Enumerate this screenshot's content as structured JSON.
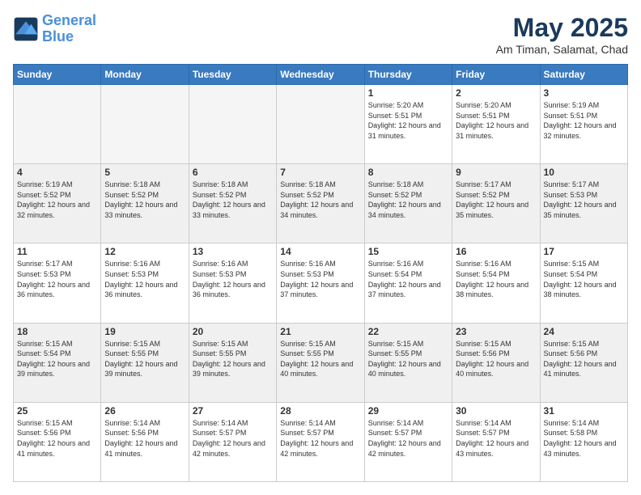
{
  "header": {
    "logo_line1": "General",
    "logo_line2": "Blue",
    "month_title": "May 2025",
    "location": "Am Timan, Salamat, Chad"
  },
  "days_of_week": [
    "Sunday",
    "Monday",
    "Tuesday",
    "Wednesday",
    "Thursday",
    "Friday",
    "Saturday"
  ],
  "weeks": [
    [
      {
        "day": "",
        "empty": true
      },
      {
        "day": "",
        "empty": true
      },
      {
        "day": "",
        "empty": true
      },
      {
        "day": "",
        "empty": true
      },
      {
        "day": "1",
        "sunrise": "5:20 AM",
        "sunset": "5:51 PM",
        "daylight": "12 hours and 31 minutes."
      },
      {
        "day": "2",
        "sunrise": "5:20 AM",
        "sunset": "5:51 PM",
        "daylight": "12 hours and 31 minutes."
      },
      {
        "day": "3",
        "sunrise": "5:19 AM",
        "sunset": "5:51 PM",
        "daylight": "12 hours and 32 minutes."
      }
    ],
    [
      {
        "day": "4",
        "sunrise": "5:19 AM",
        "sunset": "5:52 PM",
        "daylight": "12 hours and 32 minutes."
      },
      {
        "day": "5",
        "sunrise": "5:18 AM",
        "sunset": "5:52 PM",
        "daylight": "12 hours and 33 minutes."
      },
      {
        "day": "6",
        "sunrise": "5:18 AM",
        "sunset": "5:52 PM",
        "daylight": "12 hours and 33 minutes."
      },
      {
        "day": "7",
        "sunrise": "5:18 AM",
        "sunset": "5:52 PM",
        "daylight": "12 hours and 34 minutes."
      },
      {
        "day": "8",
        "sunrise": "5:18 AM",
        "sunset": "5:52 PM",
        "daylight": "12 hours and 34 minutes."
      },
      {
        "day": "9",
        "sunrise": "5:17 AM",
        "sunset": "5:52 PM",
        "daylight": "12 hours and 35 minutes."
      },
      {
        "day": "10",
        "sunrise": "5:17 AM",
        "sunset": "5:53 PM",
        "daylight": "12 hours and 35 minutes."
      }
    ],
    [
      {
        "day": "11",
        "sunrise": "5:17 AM",
        "sunset": "5:53 PM",
        "daylight": "12 hours and 36 minutes."
      },
      {
        "day": "12",
        "sunrise": "5:16 AM",
        "sunset": "5:53 PM",
        "daylight": "12 hours and 36 minutes."
      },
      {
        "day": "13",
        "sunrise": "5:16 AM",
        "sunset": "5:53 PM",
        "daylight": "12 hours and 36 minutes."
      },
      {
        "day": "14",
        "sunrise": "5:16 AM",
        "sunset": "5:53 PM",
        "daylight": "12 hours and 37 minutes."
      },
      {
        "day": "15",
        "sunrise": "5:16 AM",
        "sunset": "5:54 PM",
        "daylight": "12 hours and 37 minutes."
      },
      {
        "day": "16",
        "sunrise": "5:16 AM",
        "sunset": "5:54 PM",
        "daylight": "12 hours and 38 minutes."
      },
      {
        "day": "17",
        "sunrise": "5:15 AM",
        "sunset": "5:54 PM",
        "daylight": "12 hours and 38 minutes."
      }
    ],
    [
      {
        "day": "18",
        "sunrise": "5:15 AM",
        "sunset": "5:54 PM",
        "daylight": "12 hours and 39 minutes."
      },
      {
        "day": "19",
        "sunrise": "5:15 AM",
        "sunset": "5:55 PM",
        "daylight": "12 hours and 39 minutes."
      },
      {
        "day": "20",
        "sunrise": "5:15 AM",
        "sunset": "5:55 PM",
        "daylight": "12 hours and 39 minutes."
      },
      {
        "day": "21",
        "sunrise": "5:15 AM",
        "sunset": "5:55 PM",
        "daylight": "12 hours and 40 minutes."
      },
      {
        "day": "22",
        "sunrise": "5:15 AM",
        "sunset": "5:55 PM",
        "daylight": "12 hours and 40 minutes."
      },
      {
        "day": "23",
        "sunrise": "5:15 AM",
        "sunset": "5:56 PM",
        "daylight": "12 hours and 40 minutes."
      },
      {
        "day": "24",
        "sunrise": "5:15 AM",
        "sunset": "5:56 PM",
        "daylight": "12 hours and 41 minutes."
      }
    ],
    [
      {
        "day": "25",
        "sunrise": "5:15 AM",
        "sunset": "5:56 PM",
        "daylight": "12 hours and 41 minutes."
      },
      {
        "day": "26",
        "sunrise": "5:14 AM",
        "sunset": "5:56 PM",
        "daylight": "12 hours and 41 minutes."
      },
      {
        "day": "27",
        "sunrise": "5:14 AM",
        "sunset": "5:57 PM",
        "daylight": "12 hours and 42 minutes."
      },
      {
        "day": "28",
        "sunrise": "5:14 AM",
        "sunset": "5:57 PM",
        "daylight": "12 hours and 42 minutes."
      },
      {
        "day": "29",
        "sunrise": "5:14 AM",
        "sunset": "5:57 PM",
        "daylight": "12 hours and 42 minutes."
      },
      {
        "day": "30",
        "sunrise": "5:14 AM",
        "sunset": "5:57 PM",
        "daylight": "12 hours and 43 minutes."
      },
      {
        "day": "31",
        "sunrise": "5:14 AM",
        "sunset": "5:58 PM",
        "daylight": "12 hours and 43 minutes."
      }
    ]
  ]
}
